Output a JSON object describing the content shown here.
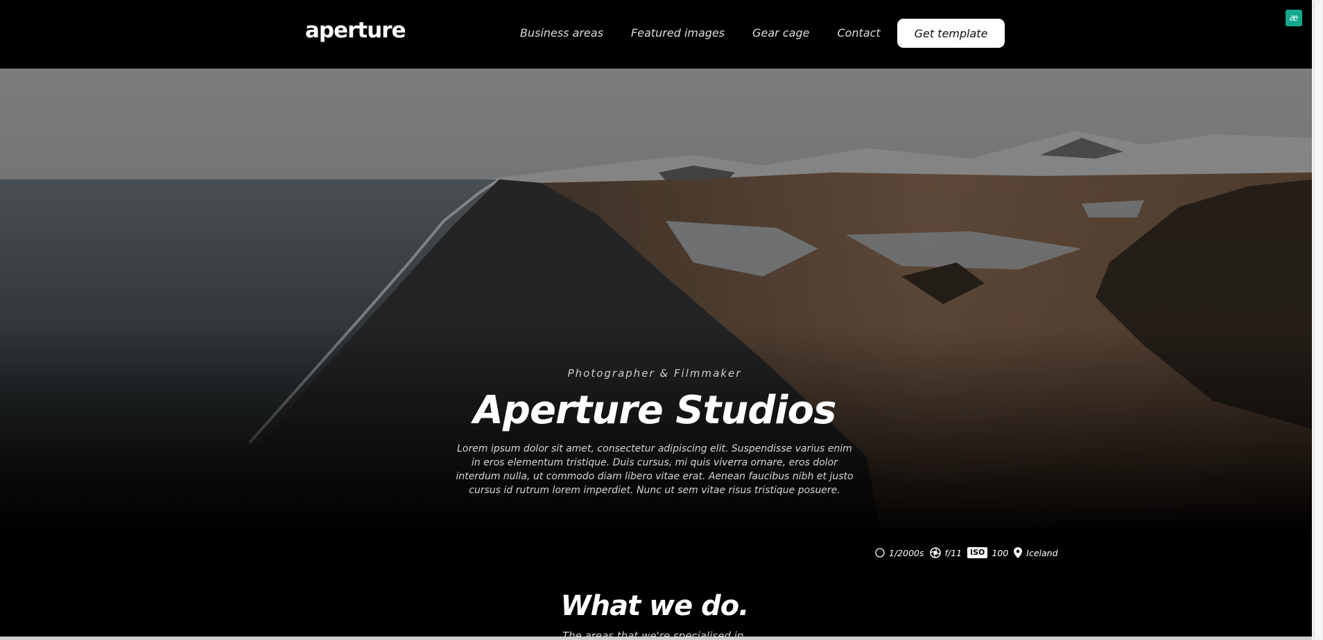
{
  "nav": {
    "logo": "aperture",
    "links": [
      "Business areas",
      "Featured images",
      "Gear cage",
      "Contact"
    ],
    "cta": "Get template",
    "corner_badge": "æ"
  },
  "hero": {
    "eyebrow": "Photographer & Filmmaker",
    "title": "Aperture Studios",
    "lead": "Lorem ipsum dolor sit amet, consectetur adipiscing elit. Suspendisse varius enim in eros elementum tristique. Duis cursus, mi quis viverra ornare, eros dolor interdum nulla, ut commodo diam libero vitae erat. Aenean faucibus nibh et justo cursus id rutrum lorem imperdiet. Nunc ut sem vitae risus tristique posuere."
  },
  "exif": {
    "shutter": "1/2000s",
    "aperture": "f/11",
    "iso_label": "ISO",
    "iso_value": "100",
    "location": "Iceland",
    "icons": [
      "shutter-icon",
      "aperture-icon",
      "iso-icon",
      "location-pin-icon"
    ]
  },
  "section": {
    "title": "What we do.",
    "subtitle": "The areas that we're specialised in."
  },
  "colors": {
    "background": "#000000",
    "badge": "#14a88f"
  }
}
